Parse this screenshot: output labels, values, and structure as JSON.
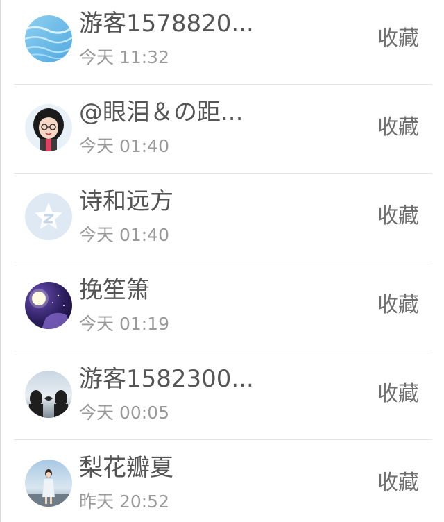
{
  "rows": [
    {
      "name": "游客1578820...",
      "time": "今天 11:32",
      "action": "收藏",
      "avatar": "avatar-sky-water"
    },
    {
      "name": "@眼泪＆の距...",
      "time": "今天 01:40",
      "action": "收藏",
      "avatar": "avatar-anime-girl-glasses"
    },
    {
      "name": "诗和远方",
      "time": "今天 01:40",
      "action": "收藏",
      "avatar": "avatar-default-star"
    },
    {
      "name": "挽笙箫",
      "time": "今天 01:19",
      "action": "收藏",
      "avatar": "avatar-purple-moon"
    },
    {
      "name": "游客1582300...",
      "time": "今天 00:05",
      "action": "收藏",
      "avatar": "avatar-two-silhouettes"
    },
    {
      "name": "梨花瓣夏",
      "time": "昨天 20:52",
      "action": "收藏",
      "avatar": "avatar-girl-photo"
    }
  ]
}
